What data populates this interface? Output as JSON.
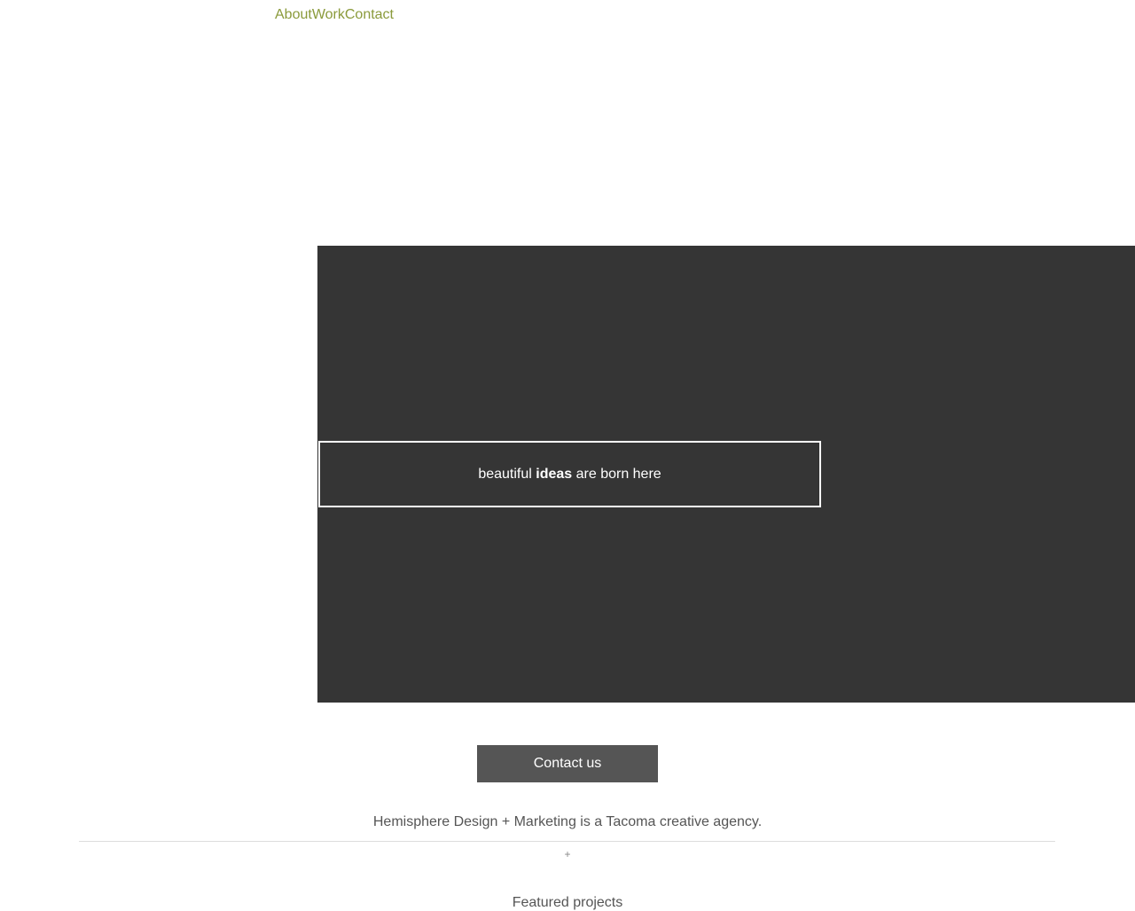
{
  "colors": {
    "nav_link": "#8a9a3a",
    "hero_bg": "#353535",
    "button_bg": "#555555",
    "body_text": "#555555",
    "divider": "#dddddd",
    "plus": "#888888"
  },
  "nav": {
    "items": [
      {
        "label": "About"
      },
      {
        "label": "Work"
      },
      {
        "label": "Contact"
      }
    ]
  },
  "hero": {
    "text_before": "beautiful ",
    "text_bold": "ideas",
    "text_after": " are born here"
  },
  "cta": {
    "label": "Contact us"
  },
  "intro": {
    "tagline": "Hemisphere Design + Marketing is a Tacoma creative agency.",
    "divider_symbol": "+",
    "section_heading": "Featured projects"
  }
}
